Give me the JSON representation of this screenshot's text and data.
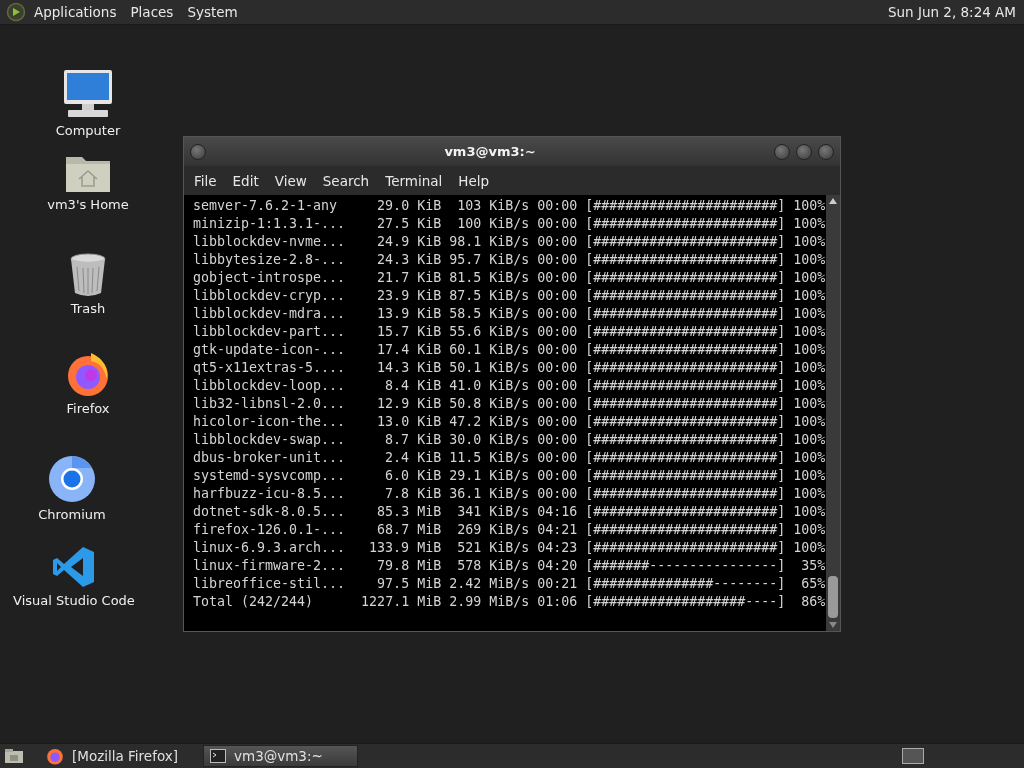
{
  "top_panel": {
    "menus": [
      "Applications",
      "Places",
      "System"
    ],
    "clock": "Sun Jun 2, 8:24 AM"
  },
  "desktop_icons": [
    {
      "label": "Computer",
      "kind": "computer"
    },
    {
      "label": "vm3's Home",
      "kind": "home"
    },
    {
      "label": "Trash",
      "kind": "trash"
    },
    {
      "label": "Firefox",
      "kind": "firefox"
    },
    {
      "label": "Chromium",
      "kind": "chromium"
    },
    {
      "label": "Visual Studio Code",
      "kind": "vscode"
    }
  ],
  "terminal": {
    "title": "vm3@vm3:~",
    "menu": [
      "File",
      "Edit",
      "View",
      "Search",
      "Terminal",
      "Help"
    ],
    "rows": [
      {
        "name": "semver-7.6.2-1-any",
        "size": "29.0 KiB",
        "rate": "103 KiB/s",
        "eta": "00:00",
        "bar": "[#######################]",
        "percent": "100%"
      },
      {
        "name": "minizip-1:1.3.1-...",
        "size": "27.5 KiB",
        "rate": "100 KiB/s",
        "eta": "00:00",
        "bar": "[#######################]",
        "percent": "100%"
      },
      {
        "name": "libblockdev-nvme...",
        "size": "24.9 KiB",
        "rate": "98.1 KiB/s",
        "eta": "00:00",
        "bar": "[#######################]",
        "percent": "100%"
      },
      {
        "name": "libbytesize-2.8-...",
        "size": "24.3 KiB",
        "rate": "95.7 KiB/s",
        "eta": "00:00",
        "bar": "[#######################]",
        "percent": "100%"
      },
      {
        "name": "gobject-introspe...",
        "size": "21.7 KiB",
        "rate": "81.5 KiB/s",
        "eta": "00:00",
        "bar": "[#######################]",
        "percent": "100%"
      },
      {
        "name": "libblockdev-cryp...",
        "size": "23.9 KiB",
        "rate": "87.5 KiB/s",
        "eta": "00:00",
        "bar": "[#######################]",
        "percent": "100%"
      },
      {
        "name": "libblockdev-mdra...",
        "size": "13.9 KiB",
        "rate": "58.5 KiB/s",
        "eta": "00:00",
        "bar": "[#######################]",
        "percent": "100%"
      },
      {
        "name": "libblockdev-part...",
        "size": "15.7 KiB",
        "rate": "55.6 KiB/s",
        "eta": "00:00",
        "bar": "[#######################]",
        "percent": "100%"
      },
      {
        "name": "gtk-update-icon-...",
        "size": "17.4 KiB",
        "rate": "60.1 KiB/s",
        "eta": "00:00",
        "bar": "[#######################]",
        "percent": "100%"
      },
      {
        "name": "qt5-x11extras-5....",
        "size": "14.3 KiB",
        "rate": "50.1 KiB/s",
        "eta": "00:00",
        "bar": "[#######################]",
        "percent": "100%"
      },
      {
        "name": "libblockdev-loop...",
        "size": "8.4 KiB",
        "rate": "41.0 KiB/s",
        "eta": "00:00",
        "bar": "[#######################]",
        "percent": "100%"
      },
      {
        "name": "lib32-libnsl-2.0...",
        "size": "12.9 KiB",
        "rate": "50.8 KiB/s",
        "eta": "00:00",
        "bar": "[#######################]",
        "percent": "100%"
      },
      {
        "name": "hicolor-icon-the...",
        "size": "13.0 KiB",
        "rate": "47.2 KiB/s",
        "eta": "00:00",
        "bar": "[#######################]",
        "percent": "100%"
      },
      {
        "name": "libblockdev-swap...",
        "size": "8.7 KiB",
        "rate": "30.0 KiB/s",
        "eta": "00:00",
        "bar": "[#######################]",
        "percent": "100%"
      },
      {
        "name": "dbus-broker-unit...",
        "size": "2.4 KiB",
        "rate": "11.5 KiB/s",
        "eta": "00:00",
        "bar": "[#######################]",
        "percent": "100%"
      },
      {
        "name": "systemd-sysvcomp...",
        "size": "6.0 KiB",
        "rate": "29.1 KiB/s",
        "eta": "00:00",
        "bar": "[#######################]",
        "percent": "100%"
      },
      {
        "name": "harfbuzz-icu-8.5...",
        "size": "7.8 KiB",
        "rate": "36.1 KiB/s",
        "eta": "00:00",
        "bar": "[#######################]",
        "percent": "100%"
      },
      {
        "name": "dotnet-sdk-8.0.5...",
        "size": "85.3 MiB",
        "rate": "341 KiB/s",
        "eta": "04:16",
        "bar": "[#######################]",
        "percent": "100%"
      },
      {
        "name": "firefox-126.0.1-...",
        "size": "68.7 MiB",
        "rate": "269 KiB/s",
        "eta": "04:21",
        "bar": "[#######################]",
        "percent": "100%"
      },
      {
        "name": "linux-6.9.3.arch...",
        "size": "133.9 MiB",
        "rate": "521 KiB/s",
        "eta": "04:23",
        "bar": "[#######################]",
        "percent": "100%"
      },
      {
        "name": "linux-firmware-2...",
        "size": "79.8 MiB",
        "rate": "578 KiB/s",
        "eta": "04:20",
        "bar": "[#######----------------]",
        "percent": "35%"
      },
      {
        "name": "libreoffice-stil...",
        "size": "97.5 MiB",
        "rate": "2.42 MiB/s",
        "eta": "00:21",
        "bar": "[###############--------]",
        "percent": "65%"
      },
      {
        "name": "Total (242/244)",
        "size": "1227.1 MiB",
        "rate": "2.99 MiB/s",
        "eta": "01:06",
        "bar": "[###################----]",
        "percent": "86%"
      }
    ]
  },
  "taskbar": {
    "tasks": [
      {
        "label": "[Mozilla Firefox]",
        "kind": "firefox",
        "selected": false
      },
      {
        "label": "vm3@vm3:~",
        "kind": "terminal",
        "selected": true
      }
    ]
  }
}
